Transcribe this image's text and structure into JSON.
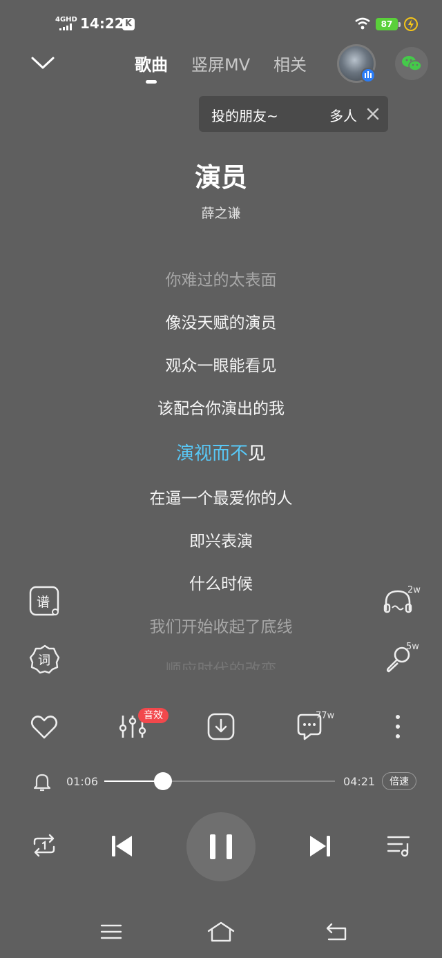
{
  "status_bar": {
    "network": "4GHD",
    "time": "14:22",
    "app_badge": "K",
    "battery": "87"
  },
  "header": {
    "tabs": [
      {
        "label": "歌曲",
        "active": true
      },
      {
        "label": "竖屏MV",
        "active": false
      },
      {
        "label": "相关",
        "active": false
      }
    ]
  },
  "share_tip": {
    "text": "投的朋友~",
    "multi_label": "多人"
  },
  "song": {
    "title": "演员",
    "artist": "薛之谦"
  },
  "lyrics": {
    "lines": [
      "你难过的太表面",
      "像没天赋的演员",
      "观众一眼能看见",
      "该配合你演出的我",
      "演视而不见",
      "在逼一个最爱你的人",
      "即兴表演",
      "什么时候",
      "我们开始收起了底线",
      "顺应时代的改变"
    ],
    "current_sung": "演视而不",
    "current_rest": "见"
  },
  "side": {
    "score_label": "谱",
    "lyric_label": "词",
    "listen_count": "2w",
    "sing_count": "5w"
  },
  "actions": {
    "sfx_badge": "音效",
    "comment_count": "77w"
  },
  "progress": {
    "current": "01:06",
    "total": "04:21",
    "fraction": 0.253,
    "speed_label": "倍速"
  },
  "colors": {
    "background": "#5f5f5f",
    "lyric_highlight": "#58c8f7",
    "sfx_badge": "#f2484c",
    "battery": "#5ad03a"
  },
  "icons": [
    "chevron-down-icon",
    "wechat-icon",
    "close-icon",
    "score-icon",
    "lyric-icon",
    "headphone-icon",
    "microphone-icon",
    "heart-icon",
    "equalizer-icon",
    "download-icon",
    "comment-icon",
    "more-icon",
    "bell-icon",
    "repeat-one-icon",
    "previous-icon",
    "pause-icon",
    "next-icon",
    "playlist-icon",
    "menu-icon",
    "home-icon",
    "back-icon"
  ]
}
